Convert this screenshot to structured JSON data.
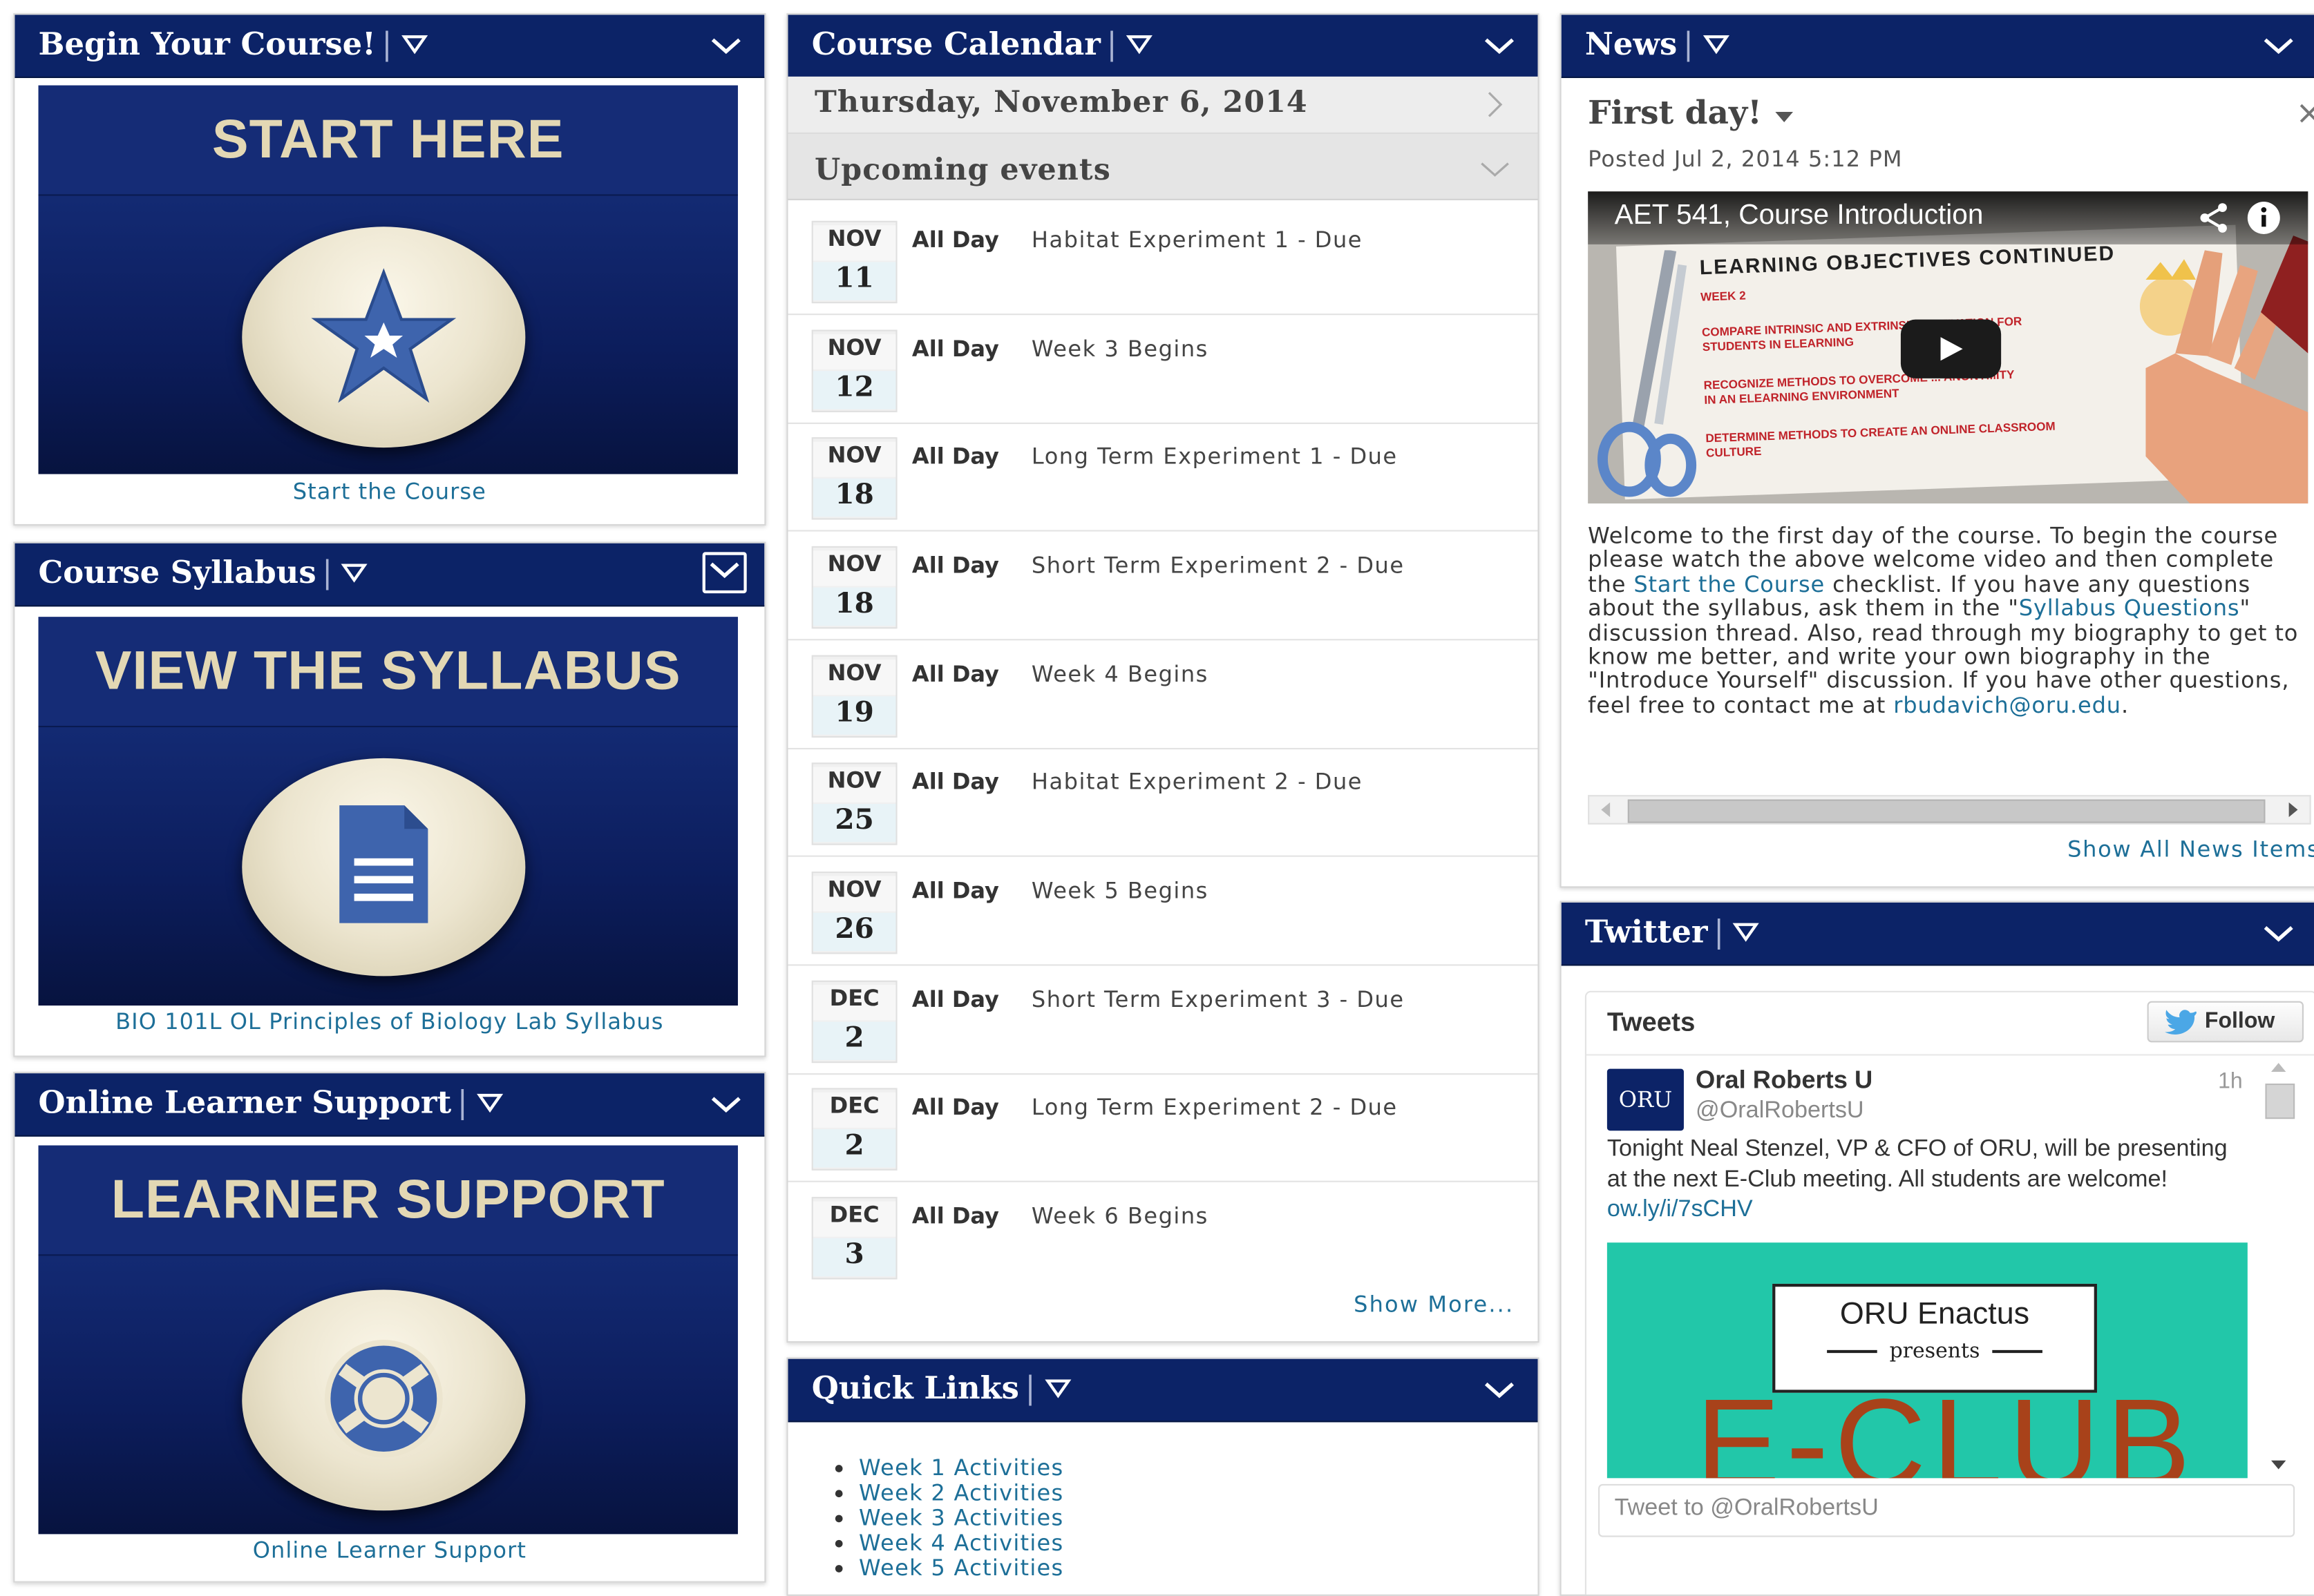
{
  "begin": {
    "title": "Begin Your Course!",
    "banner": "START HERE",
    "caption": "Start the Course"
  },
  "syllabus": {
    "title": "Course Syllabus",
    "banner": "VIEW THE SYLLABUS",
    "caption": "BIO 101L OL Principles of Biology Lab Syllabus"
  },
  "support": {
    "title": "Online Learner Support",
    "banner": "LEARNER SUPPORT",
    "caption": "Online Learner Support"
  },
  "calendar": {
    "title": "Course Calendar",
    "date": "Thursday, November 6, 2014",
    "upcoming": "Upcoming events",
    "all_day": "All Day",
    "events": [
      {
        "month": "NOV",
        "day": "11",
        "title": "Habitat Experiment 1 - Due"
      },
      {
        "month": "NOV",
        "day": "12",
        "title": "Week 3 Begins"
      },
      {
        "month": "NOV",
        "day": "18",
        "title": "Long Term Experiment 1 - Due"
      },
      {
        "month": "NOV",
        "day": "18",
        "title": "Short Term Experiment 2 - Due"
      },
      {
        "month": "NOV",
        "day": "19",
        "title": "Week 4 Begins"
      },
      {
        "month": "NOV",
        "day": "25",
        "title": "Habitat Experiment 2 - Due"
      },
      {
        "month": "NOV",
        "day": "26",
        "title": "Week 5 Begins"
      },
      {
        "month": "DEC",
        "day": "2",
        "title": "Short Term Experiment 3 - Due"
      },
      {
        "month": "DEC",
        "day": "2",
        "title": "Long Term Experiment 2 - Due"
      },
      {
        "month": "DEC",
        "day": "3",
        "title": "Week 6 Begins"
      }
    ],
    "show_more": "Show More..."
  },
  "quick_links": {
    "title": "Quick Links",
    "items": [
      "Week 1 Activities",
      "Week 2 Activities",
      "Week 3 Activities",
      "Week 4 Activities",
      "Week 5 Activities"
    ]
  },
  "news": {
    "title": "News",
    "item_title": "First day!",
    "posted": "Posted Jul 2, 2014 5:12 PM",
    "close": "×",
    "video_title": "AET 541, Course Introduction",
    "board_heading": "LEARNING OBJECTIVES CONTINUED",
    "board_lines": [
      "WEEK 2",
      "COMPARE INTRINSIC AND EXTRINSIC MOTIVATION FOR",
      "STUDENTS IN ELEARNING",
      "RECOGNIZE METHODS TO OVERCOME ... ANONYMITY",
      "IN AN ELEARNING ENVIRONMENT",
      "DETERMINE METHODS TO CREATE AN ONLINE CLASSROOM",
      "CULTURE"
    ],
    "body_1": "Welcome to the first day of the course. To begin the course please watch the above welcome video and then complete the ",
    "body_link_1": "Start the Course",
    "body_2": " checklist.  If you have any questions about the syllabus, ask them in the \"",
    "body_link_2": "Syllabus Questions",
    "body_3": "\" discussion thread. Also, read through my biography to get to know me better, and write your own biography in the \"Introduce Yourself\" discussion. If you have other questions, feel free to contact me at ",
    "body_email": "rbudavich@oru.edu",
    "body_4": ".",
    "show_all": "Show All News Items"
  },
  "twitter": {
    "title": "Twitter",
    "tweets_label": "Tweets",
    "follow_label": "Follow",
    "logo_text": "ORU",
    "name": "Oral Roberts U",
    "handle": "@OralRobertsU",
    "time": "1h",
    "text": "Tonight Neal Stenzel, VP & CFO of ORU, will be presenting at the next E-Club meeting. All students are welcome! ",
    "text_link": "ow.ly/i/7sCHV",
    "image_title": "ORU Enactus",
    "image_presents": "presents",
    "image_big": "E-CLUB",
    "input_placeholder": "Tweet to @OralRobertsU"
  },
  "colors": {
    "header": "#0c2367",
    "link": "#1d6f98",
    "banner": "#10246b",
    "circle": "#ece5cf",
    "twitter_card": "#22c7a9"
  }
}
